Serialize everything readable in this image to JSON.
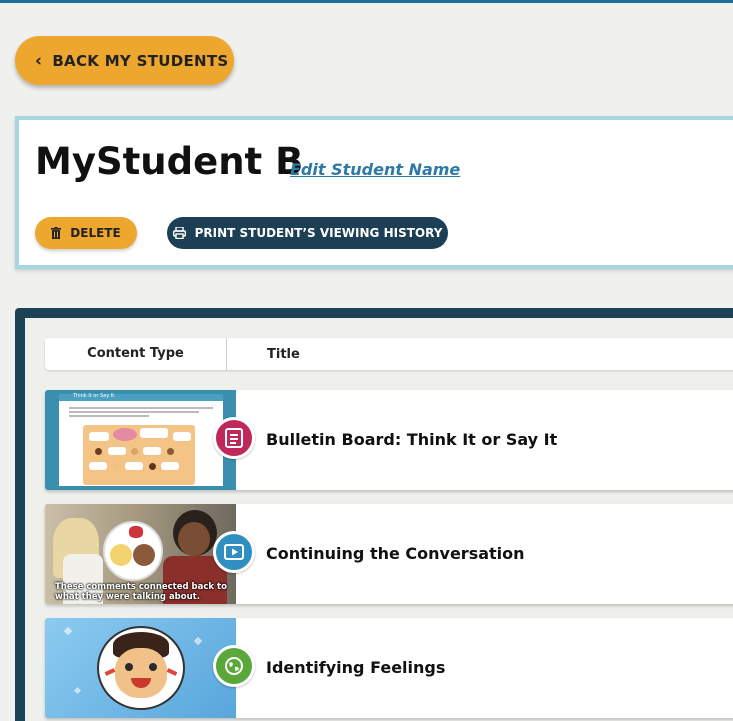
{
  "nav": {
    "back_label": "BACK MY STUDENTS"
  },
  "student": {
    "name": "MyStudent B",
    "edit_label": "Edit Student Name",
    "delete_label": "DELETE",
    "print_label": "PRINT STUDENT’S VIEWING HISTORY"
  },
  "table": {
    "columns": [
      "Content Type",
      "Title"
    ],
    "rows": [
      {
        "title": "Bulletin Board: Think It or Say It",
        "type_icon": "document-icon",
        "badge_color": "#c0275a",
        "thumb_heading": "Think It or Say It"
      },
      {
        "title": "Continuing the Conversation",
        "type_icon": "video-icon",
        "badge_color": "#2f8fc1",
        "caption": "These comments connected back to what they were talking about."
      },
      {
        "title": "Identifying Feelings",
        "type_icon": "interactive-icon",
        "badge_color": "#5aa83a"
      }
    ]
  }
}
